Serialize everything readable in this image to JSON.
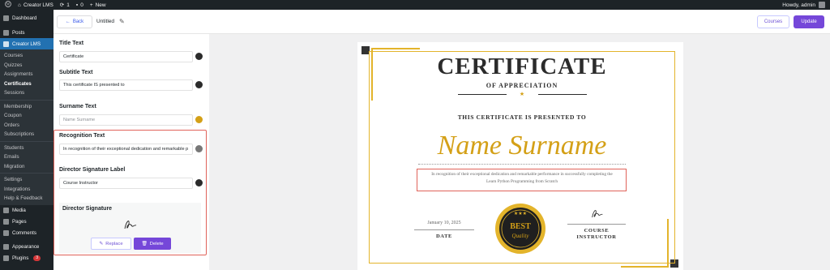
{
  "adminbar": {
    "site_name": "Creator LMS",
    "updates_count": "1",
    "comments_count": "0",
    "new_label": "New",
    "howdy": "Howdy, admin"
  },
  "sidebar": {
    "dashboard": "Dashboard",
    "posts": "Posts",
    "creator_lms": "Creator LMS",
    "submenu": [
      "Courses",
      "Quizzes",
      "Assignments",
      "Certificates",
      "Sessions",
      "Membership",
      "Coupon",
      "Orders",
      "Subscriptions",
      "Students",
      "Emails",
      "Migration",
      "Settings",
      "Integrations",
      "Help & Feedback"
    ],
    "media": "Media",
    "pages": "Pages",
    "comments": "Comments",
    "appearance": "Appearance",
    "plugins": "Plugins",
    "plugins_badge": "3"
  },
  "topbar": {
    "back_label": "Back",
    "document_title": "Untitled",
    "courses_label": "Courses",
    "update_label": "Update"
  },
  "panel": {
    "title_label": "Title Text",
    "title_value": "Certificate",
    "subtitle_label": "Subtitle Text",
    "subtitle_value": "This certificate IS presented to",
    "surname_label": "Surname Text",
    "surname_placeholder": "Name Surname",
    "recognition_label": "Recognition Text",
    "recognition_value": "In recognition of their exceptional dedication and remarkable p",
    "director_label_label": "Director Signature Label",
    "director_label_value": "Course Instructor",
    "director_signature_label": "Director Signature",
    "replace_label": "Replace",
    "delete_label": "Delete",
    "colors": {
      "title": "#2b2b2b",
      "subtitle": "#2b2b2b",
      "surname": "#d4a017",
      "recognition": "#777777",
      "director": "#2b2b2b"
    }
  },
  "certificate": {
    "title": "CERTIFICATE",
    "subheading": "OF APPRECIATION",
    "presented": "THIS CERTIFICATE IS PRESENTED TO",
    "name": "Name Surname",
    "recognition_line1": "In recognition of their exceptional dedication and remarkable performance in successfully completing the",
    "recognition_line2": "Learn Python Programming from Scratch",
    "date_value": "January 10, 2025",
    "date_label": "DATE",
    "badge_top": "BEST",
    "badge_bottom": "Quality",
    "instructor_line1": "COURSE",
    "instructor_line2": "INSTRUCTOR"
  }
}
